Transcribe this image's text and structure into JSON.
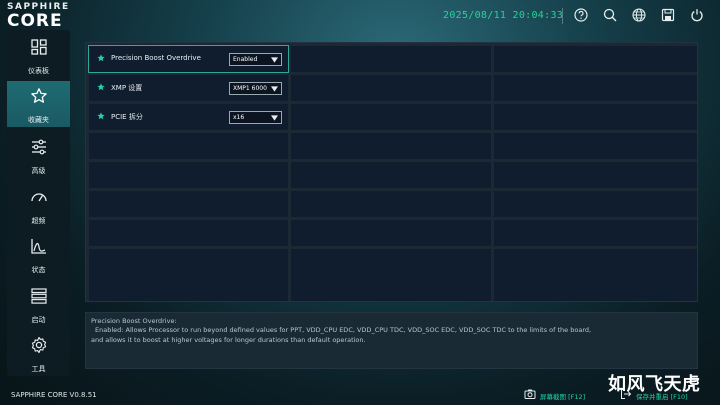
{
  "app": {
    "logo_top": "SAPPHIRE",
    "logo_main": "CORE",
    "version": "SAPPHIRE CORE V0.8.51",
    "datetime": "2025/08/11 20:04:33",
    "accent": "#27d39a"
  },
  "header_icons": [
    "help-icon",
    "search-icon",
    "globe-icon",
    "save-icon",
    "power-icon"
  ],
  "sidebar": {
    "items": [
      {
        "label": "仪表板",
        "icon": "dashboard-icon",
        "active": false
      },
      {
        "label": "收藏夹",
        "icon": "star-icon",
        "active": true
      },
      {
        "label": "高级",
        "icon": "sliders-icon",
        "active": false
      },
      {
        "label": "超频",
        "icon": "gauge-icon",
        "active": false
      },
      {
        "label": "状态",
        "icon": "status-chart-icon",
        "active": false
      },
      {
        "label": "启动",
        "icon": "boot-icon",
        "active": false
      },
      {
        "label": "工具",
        "icon": "tools-gear-icon",
        "active": false
      }
    ]
  },
  "favorites": [
    {
      "label": "Precision Boost Overdrive",
      "value": "Enabled"
    },
    {
      "label": "XMP 设置",
      "value": "XMP1 6000"
    },
    {
      "label": "PCIE 拆分",
      "value": "x16"
    }
  ],
  "description": {
    "title": "Precision Boost Overdrive:",
    "line1": "Enabled: Allows Processor to run beyond defined values for PPT, VDD_CPU EDC, VDD_CPU TDC, VDD_SOC EDC, VDD_SOC TDC to the limits of the board,",
    "line2": "and allows it to boost at higher voltages for longer durations than default operation."
  },
  "footer": {
    "screenshot_label": "屏幕截图 [F12]",
    "save_exit_label": "保存并重启 [F10]"
  },
  "watermark": "如风飞天虎"
}
